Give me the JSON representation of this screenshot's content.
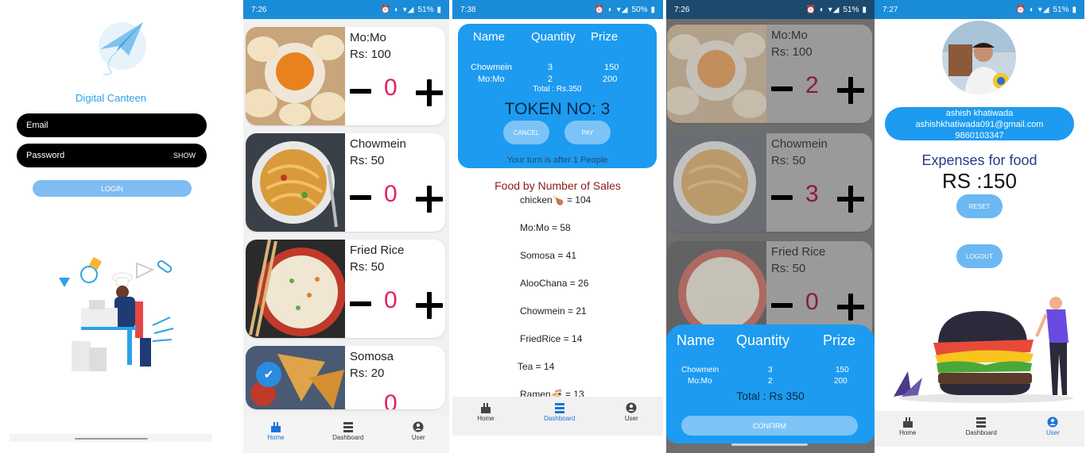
{
  "login": {
    "app_name": "Digital Canteen",
    "email_placeholder": "Email",
    "password_placeholder": "Password",
    "show_label": "SHOW",
    "login_label": "LOGIN"
  },
  "menu": {
    "time": "7:26",
    "battery": "51%",
    "items": [
      {
        "name": "Mo:Mo",
        "price": "Rs: 100",
        "qty": "0"
      },
      {
        "name": "Chowmein",
        "price": "Rs: 50",
        "qty": "0"
      },
      {
        "name": "Fried Rice",
        "price": "Rs: 50",
        "qty": "0"
      },
      {
        "name": "Somosa",
        "price": "Rs: 20",
        "qty": "0"
      }
    ]
  },
  "nav": {
    "home": "Home",
    "dashboard": "Dashboard",
    "user": "User"
  },
  "order": {
    "time": "7:38",
    "battery": "50%",
    "col_name": "Name",
    "col_qty": "Quantity",
    "col_price": "Prize",
    "rows": [
      {
        "name": "Chowmein",
        "qty": "3",
        "price": "150"
      },
      {
        "name": "Mo:Mo",
        "qty": "2",
        "price": "200"
      }
    ],
    "total": "Total : Rs.350",
    "token": "TOKEN NO: 3",
    "cancel": "CANCEL",
    "pay": "PAY",
    "turn": "Your turn is after 1 People"
  },
  "sales": {
    "title": "Food by Number of Sales",
    "items": [
      "chicken🍗 = 104",
      "Mo:Mo = 58",
      "Somosa = 41",
      "AlooChana = 26",
      "Chowmein = 21",
      "FriedRice = 14",
      "Tea = 14",
      "Ramen🍜 = 13"
    ]
  },
  "confirm": {
    "time": "7:26",
    "battery": "51%",
    "items": [
      {
        "name": "Mo:Mo",
        "price": "Rs: 100",
        "qty": "2"
      },
      {
        "name": "Chowmein",
        "price": "Rs: 50",
        "qty": "3"
      },
      {
        "name": "Fried Rice",
        "price": "Rs: 50",
        "qty": "0"
      }
    ],
    "col_name": "Name",
    "col_qty": "Quantity",
    "col_price": "Prize",
    "rows": [
      {
        "name": "Chowmein",
        "qty": "3",
        "price": "150"
      },
      {
        "name": "Mo:Mo",
        "qty": "2",
        "price": "200"
      }
    ],
    "total": "Total : Rs 350",
    "confirm_label": "CONFIRM"
  },
  "user": {
    "time": "7:27",
    "battery": "51%",
    "name": "ashish khatiwada",
    "email": "ashishkhatiwada091@gmail.com",
    "phone": "9860103347",
    "expenses_title": "Expenses for food",
    "expenses_value": "RS :150",
    "reset": "RESET",
    "logout": "LOGOUT"
  },
  "colors": {
    "primary": "#1d9bf0",
    "status_bar": "#1a8cd8",
    "qty_red": "#e0245e"
  }
}
